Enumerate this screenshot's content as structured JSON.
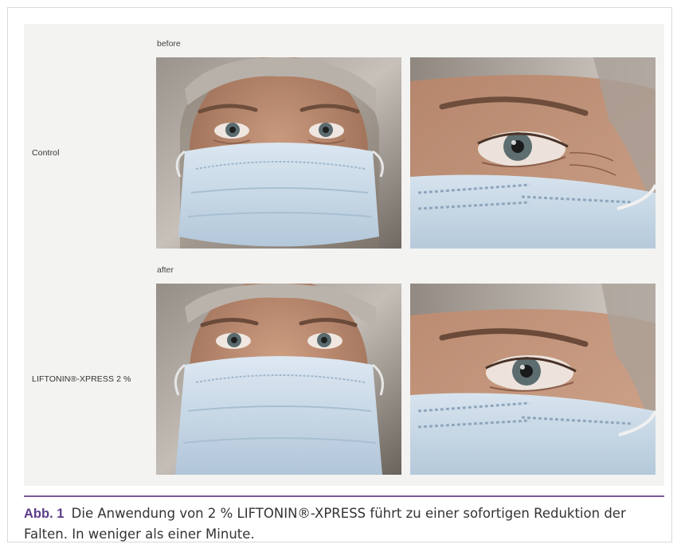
{
  "figure": {
    "before_label": "before",
    "after_label": "after",
    "rows": [
      {
        "label": "Control"
      },
      {
        "label": "LIFTONIN®-XPRESS 2 %"
      }
    ],
    "caption": {
      "label": "Abb. 1",
      "text": "Die Anwendung von 2 % LIFTONIN®-XPRESS führt zu einer sofortigen Reduktion der Falten. In weniger als einer Minute."
    }
  },
  "colors": {
    "accent": "#7b5a9e",
    "caption_label": "#5c3d8a",
    "panel_bg": "#f3f3f1",
    "mask": "#c5d7e6"
  },
  "images": [
    {
      "name": "photo-before-face",
      "depicts": "face-with-mask"
    },
    {
      "name": "photo-before-eye-closeup",
      "depicts": "eye-closeup-with-mask"
    },
    {
      "name": "photo-after-face",
      "depicts": "face-with-mask"
    },
    {
      "name": "photo-after-eye-closeup",
      "depicts": "eye-closeup-with-mask"
    }
  ]
}
